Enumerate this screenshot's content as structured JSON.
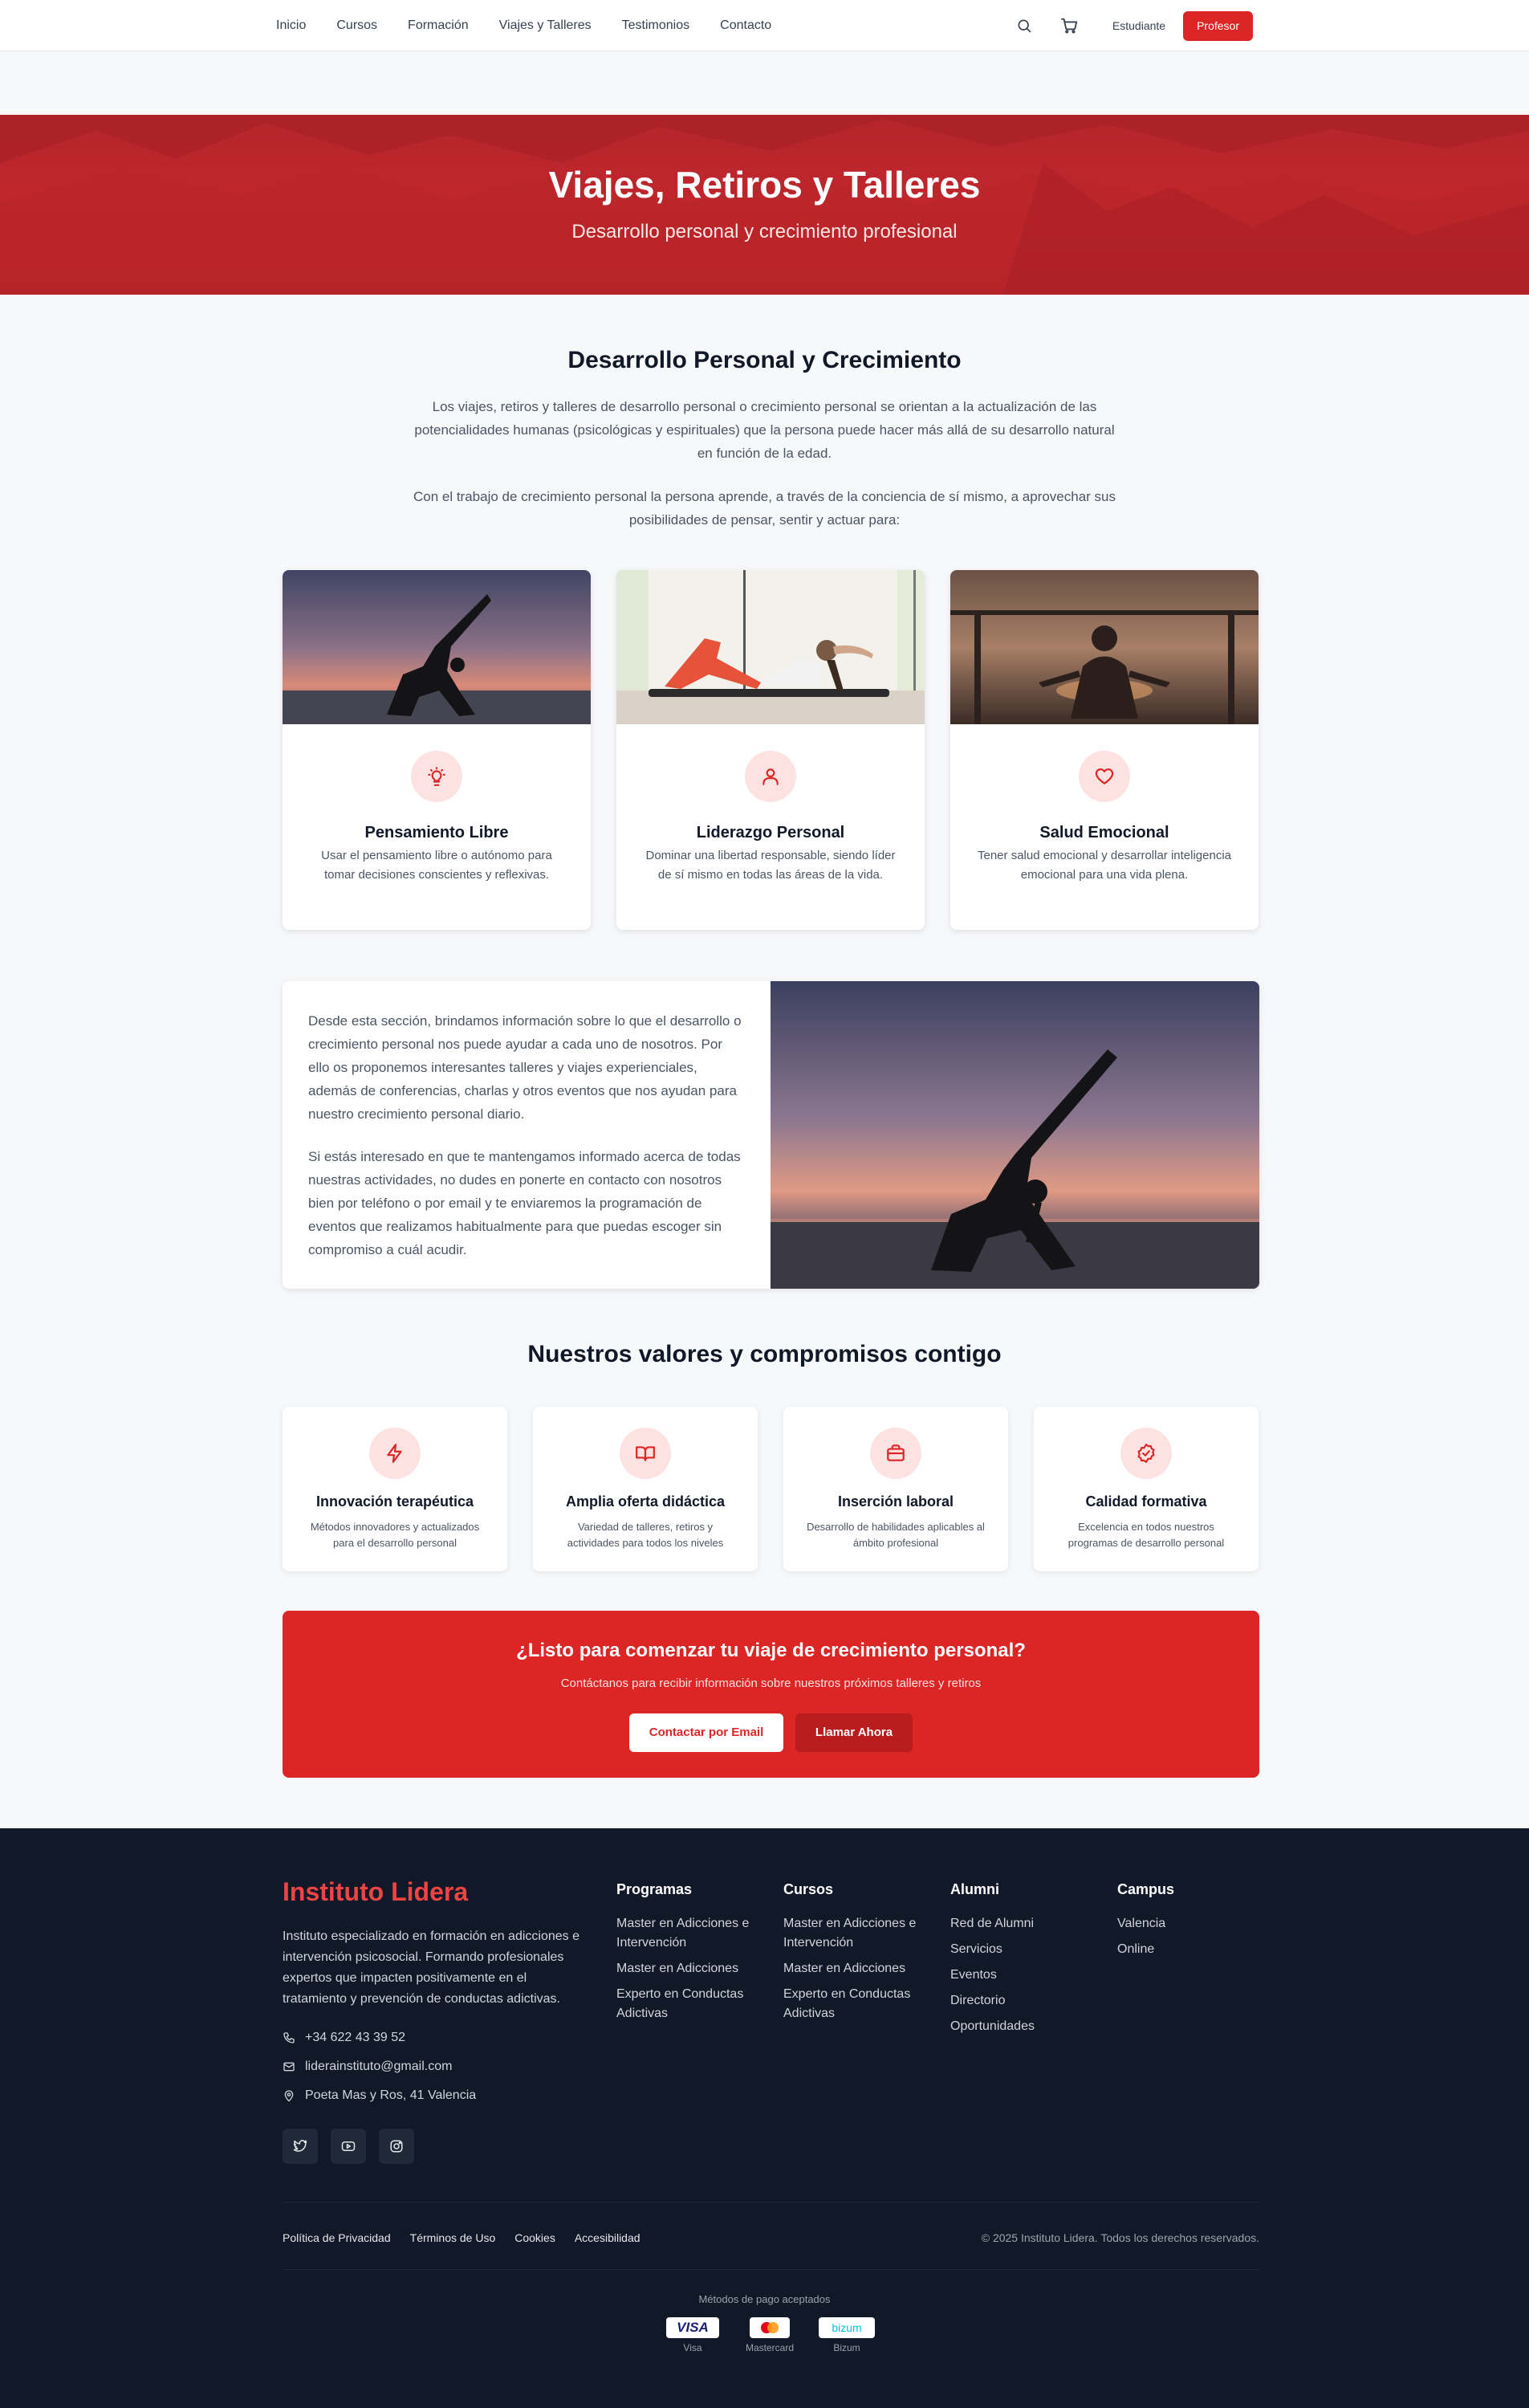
{
  "nav": {
    "links": [
      "Inicio",
      "Cursos",
      "Formación",
      "Viajes y Talleres",
      "Testimonios",
      "Contacto"
    ],
    "student_label": "Estudiante",
    "teacher_label": "Profesor"
  },
  "hero": {
    "title": "Viajes, Retiros y Talleres",
    "subtitle": "Desarrollo personal y crecimiento profesional"
  },
  "intro": {
    "title": "Desarrollo Personal y Crecimiento",
    "p1": "Los viajes, retiros y talleres de desarrollo personal o crecimiento personal se orientan a la actualización de las potencialidades humanas (psicológicas y espirituales) que la persona puede hacer más allá de su desarrollo natural en función de la edad.",
    "p2": "Con el trabajo de crecimiento personal la persona aprende, a través de la conciencia de sí mismo, a aprovechar sus posibilidades de pensar, sentir y actuar para:"
  },
  "features": [
    {
      "title": "Pensamiento Libre",
      "desc": "Usar el pensamiento libre o autónomo para tomar decisiones conscientes y reflexivas.",
      "icon": "lightbulb-icon"
    },
    {
      "title": "Liderazgo Personal",
      "desc": "Dominar una libertad responsable, siendo líder de sí mismo en todas las áreas de la vida.",
      "icon": "user-icon"
    },
    {
      "title": "Salud Emocional",
      "desc": "Tener salud emocional y desarrollar inteligencia emocional para una vida plena.",
      "icon": "heart-icon"
    }
  ],
  "info": {
    "p1": "Desde esta sección, brindamos información sobre lo que el desarrollo o crecimiento personal nos puede ayudar a cada uno de nosotros. Por ello os proponemos interesantes talleres y viajes experienciales, además de conferencias, charlas y otros eventos que nos ayudan para nuestro crecimiento personal diario.",
    "p2": "Si estás interesado en que te mantengamos informado acerca de todas nuestras actividades, no dudes en ponerte en contacto con nosotros bien por teléfono o por email y te enviaremos la programación de eventos que realizamos habitualmente para que puedas escoger sin compromiso a cuál acudir."
  },
  "values": {
    "title": "Nuestros valores y compromisos contigo",
    "items": [
      {
        "title": "Innovación terapéutica",
        "desc": "Métodos innovadores y actualizados para el desarrollo personal",
        "icon": "lightning-icon"
      },
      {
        "title": "Amplia oferta didáctica",
        "desc": "Variedad de talleres, retiros y actividades para todos los niveles",
        "icon": "book-icon"
      },
      {
        "title": "Inserción laboral",
        "desc": "Desarrollo de habilidades aplicables al ámbito profesional",
        "icon": "briefcase-icon"
      },
      {
        "title": "Calidad formativa",
        "desc": "Excelencia en todos nuestros programas de desarrollo personal",
        "icon": "badge-check-icon"
      }
    ]
  },
  "cta": {
    "title": "¿Listo para comenzar tu viaje de crecimiento personal?",
    "subtitle": "Contáctanos para recibir información sobre nuestros próximos talleres y retiros",
    "email_btn": "Contactar por Email",
    "call_btn": "Llamar Ahora"
  },
  "footer": {
    "brand": "Instituto Lidera",
    "description": "Instituto especializado en formación en adicciones e intervención psicosocial. Formando profesionales expertos que impacten positivamente en el tratamiento y prevención de conductas adictivas.",
    "phone": "+34 622 43 39 52",
    "email": "liderainstituto@gmail.com",
    "address": "Poeta Mas y Ros, 41 Valencia",
    "columns": [
      {
        "title": "Programas",
        "items": [
          "Master en Adicciones e Intervención",
          "Master en Adicciones",
          "Experto en Conductas Adictivas"
        ]
      },
      {
        "title": "Cursos",
        "items": [
          "Master en Adicciones e Intervención",
          "Master en Adicciones",
          "Experto en Conductas Adictivas"
        ]
      },
      {
        "title": "Alumni",
        "items": [
          "Red de Alumni",
          "Servicios",
          "Eventos",
          "Directorio",
          "Oportunidades"
        ]
      },
      {
        "title": "Campus",
        "items": [
          "Valencia",
          "Online"
        ]
      }
    ],
    "legal": [
      "Política de Privacidad",
      "Términos de Uso",
      "Cookies",
      "Accesibilidad"
    ],
    "copyright": "© 2025 Instituto Lidera. Todos los derechos reservados.",
    "payments_title": "Métodos de pago aceptados",
    "payments": [
      {
        "label": "Visa",
        "mark": "VISA"
      },
      {
        "label": "Mastercard",
        "mark": ""
      },
      {
        "label": "Bizum",
        "mark": "bizum"
      }
    ]
  },
  "colors": {
    "accent": "#dc2626",
    "accent_dark": "#b91c1c",
    "footer_bg": "#111827",
    "icon_bg": "#fde2e2"
  }
}
